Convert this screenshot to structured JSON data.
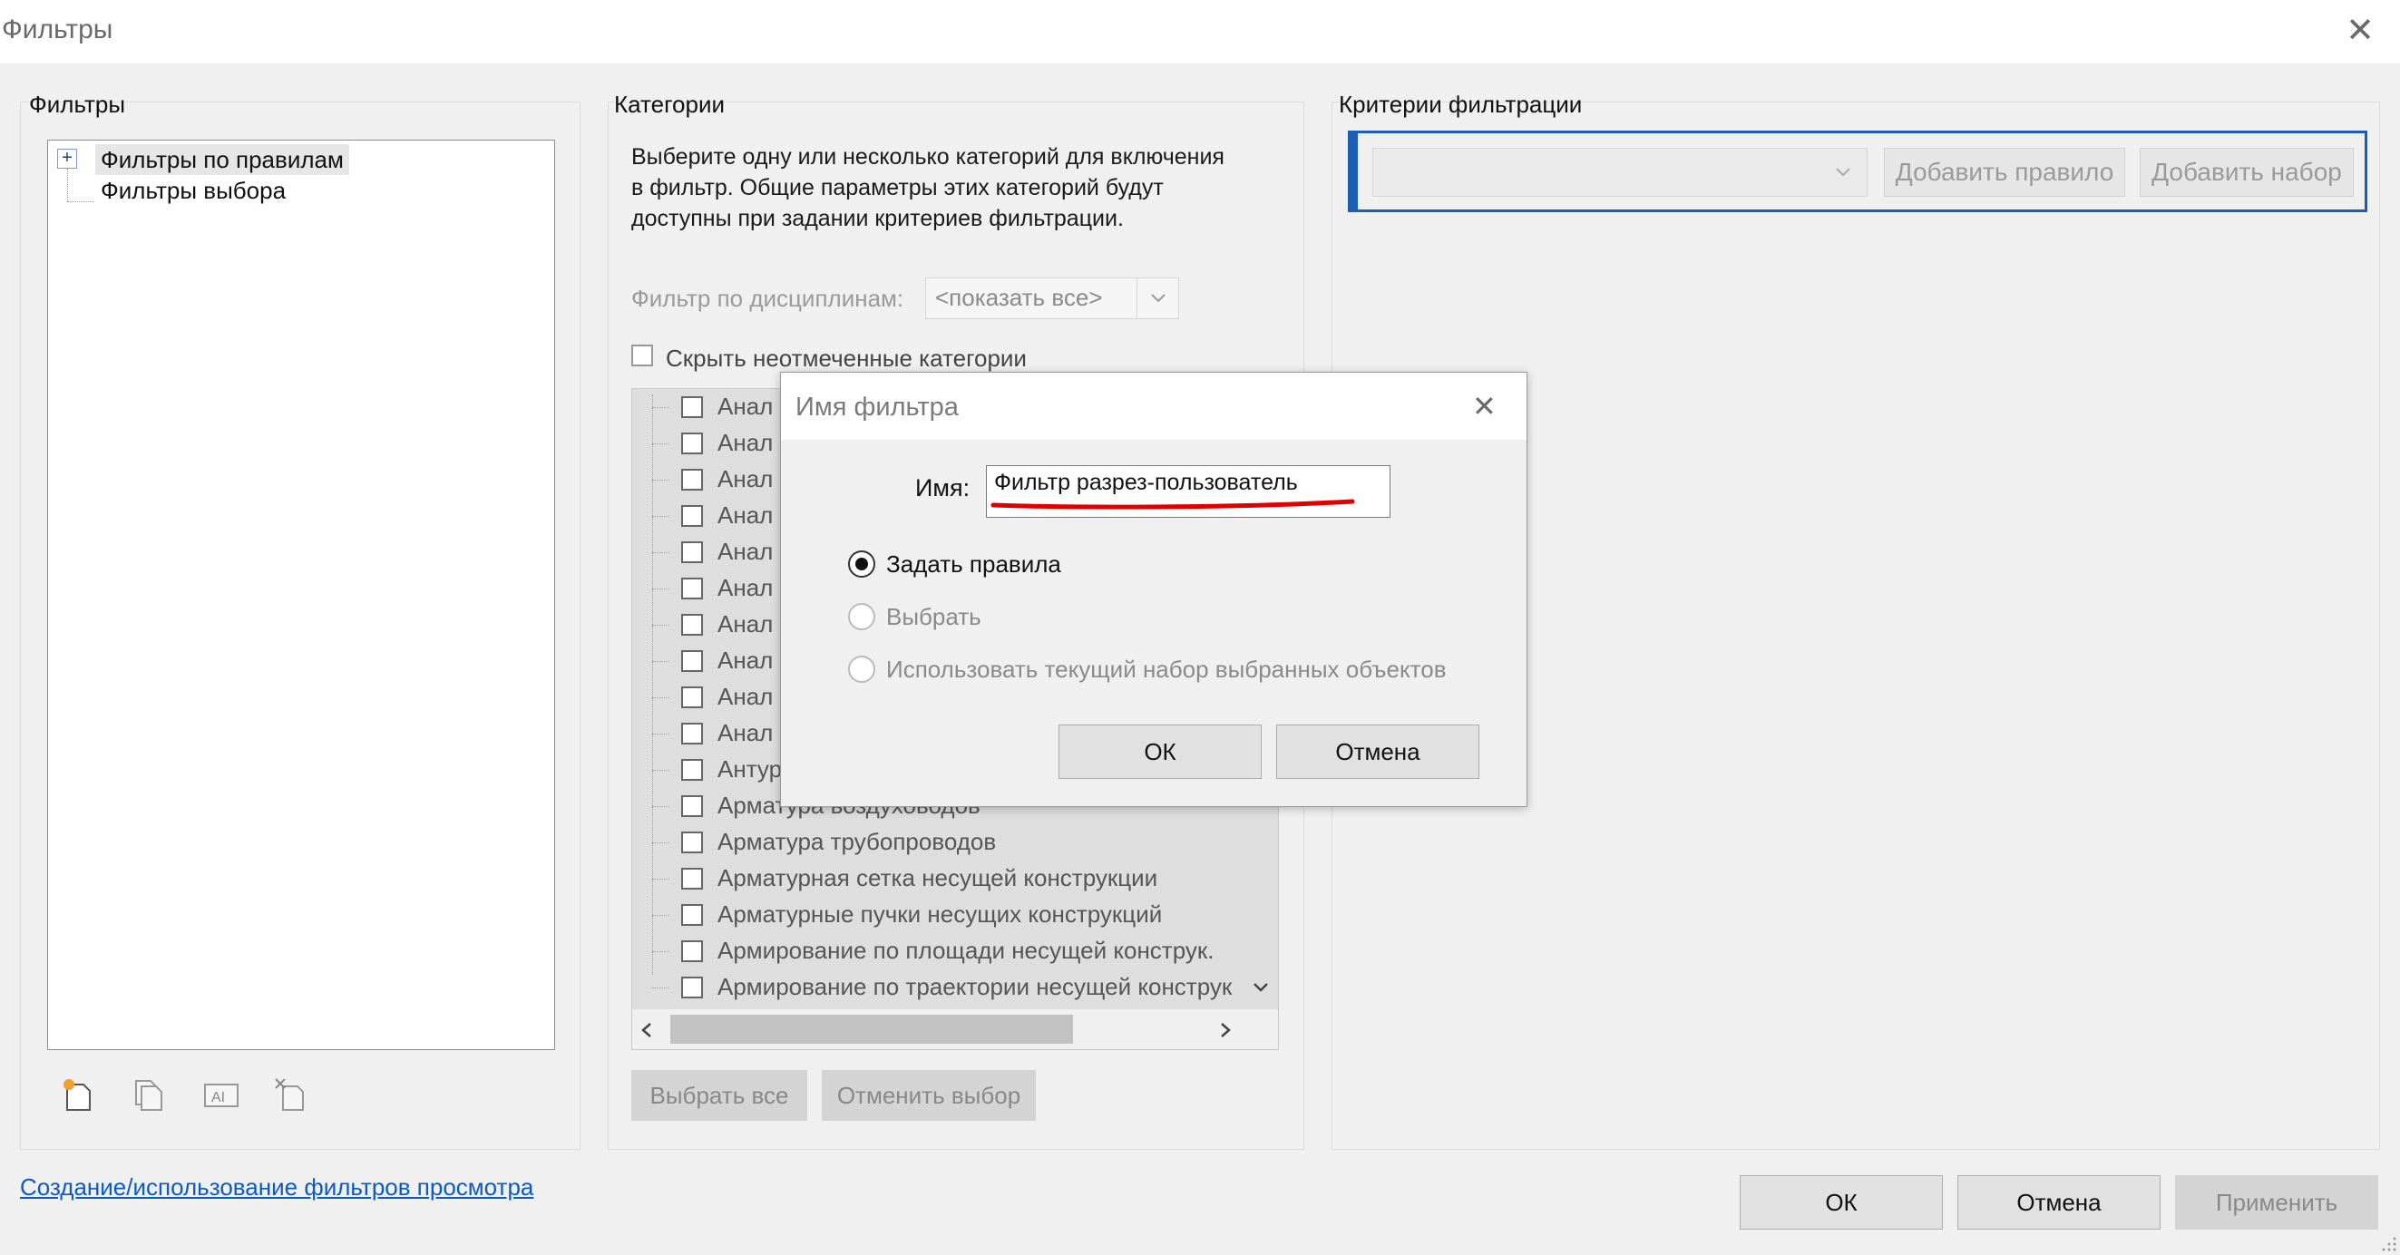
{
  "window": {
    "title": "Фильтры"
  },
  "filters_panel": {
    "title": "Фильтры",
    "tree": [
      {
        "label": "Фильтры по правилам",
        "expand": "+"
      },
      {
        "label": "Фильтры выбора"
      }
    ]
  },
  "categories_panel": {
    "title": "Категории",
    "description": [
      "Выберите одну или несколько категорий для включения",
      "в фильтр. Общие параметры этих категорий будут",
      "доступны при задании критериев фильтрации."
    ],
    "discipline_label": "Фильтр по дисциплинам:",
    "discipline_value": "<показать все>",
    "hide_unchecked_label": "Скрыть неотмеченные категории",
    "items": [
      "Анал",
      "Анал",
      "Анал",
      "Анал",
      "Анал",
      "Анал",
      "Анал",
      "Анал",
      "Анал",
      "Анал",
      "Антур",
      "Арматура воздуховодов",
      "Арматура трубопроводов",
      "Арматурная сетка несущей конструкции",
      "Арматурные пучки несущих конструкций",
      "Армирование по площади несущей конструк.",
      "Армирование по траектории несущей конструк"
    ],
    "select_all": "Выбрать все",
    "deselect": "Отменить выбор"
  },
  "criteria_panel": {
    "title": "Критерии фильтрации",
    "add_rule": "Добавить правило",
    "add_set": "Добавить набор"
  },
  "help_link": "Создание/использование фильтров просмотра",
  "footer": {
    "ok": "ОК",
    "cancel": "Отмена",
    "apply": "Применить"
  },
  "dialog": {
    "title": "Имя фильтра",
    "name_label": "Имя:",
    "name_value": "Фильтр разрез-пользователь",
    "options": [
      {
        "label": "Задать правила",
        "selected": true,
        "enabled": true
      },
      {
        "label": "Выбрать",
        "selected": false,
        "enabled": false
      },
      {
        "label": "Использовать текущий набор выбранных объектов",
        "selected": false,
        "enabled": false
      }
    ],
    "ok": "ОК",
    "cancel": "Отмена",
    "underline_color": "#e00000"
  },
  "icons": [
    "new-filter-icon",
    "duplicate-icon",
    "rename-icon",
    "delete-icon",
    "close-icon",
    "chevron-down-icon",
    "chevron-left-icon",
    "chevron-right-icon"
  ]
}
